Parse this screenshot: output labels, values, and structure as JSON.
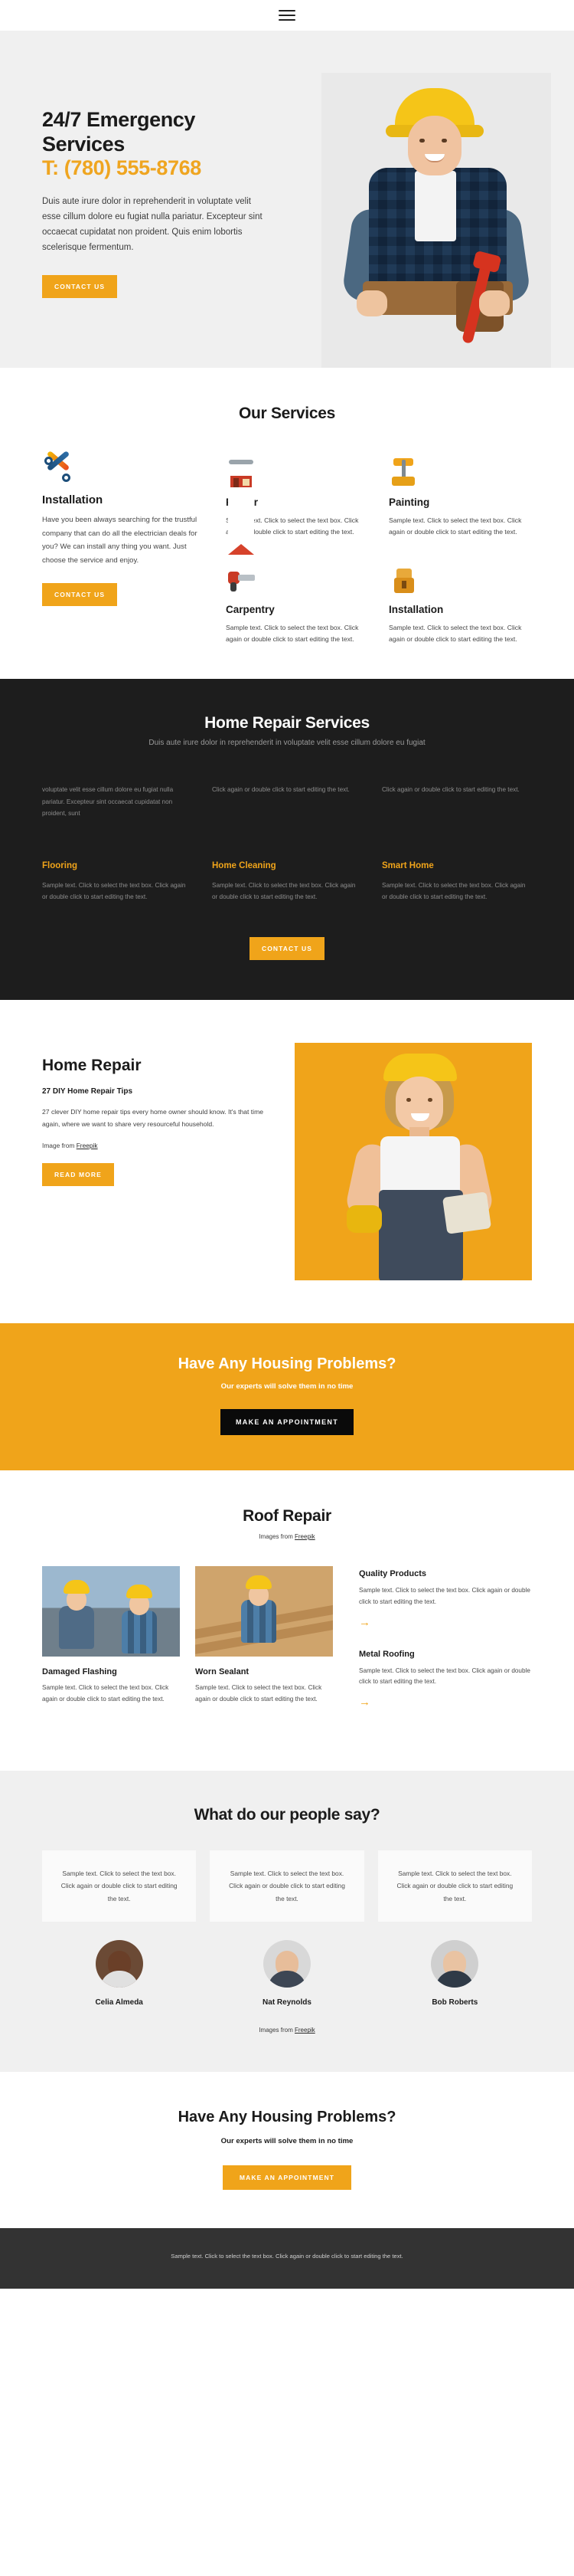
{
  "topbar": {
    "menu_icon": "hamburger-menu-icon"
  },
  "hero": {
    "title": "24/7 Emergency Services",
    "phone": "T: (780) 555-8768",
    "paragraph": "Duis aute irure dolor in reprehenderit in voluptate velit esse cillum dolore eu fugiat nulla pariatur. Excepteur sint occaecat cupidatat non proident. Quis enim lobortis scelerisque fermentum.",
    "cta": "CONTACT US",
    "image_alt": "worker-in-yellow-helmet-photo"
  },
  "services": {
    "title": "Our Services",
    "feature": {
      "icon": "crossed-tools-icon",
      "title": "Installation",
      "paragraph": "Have you been always searching for the trustful company that can do all the electrician deals for you? We can install any thing you want. Just choose the service and enjoy.",
      "cta": "CONTACT US"
    },
    "cards": [
      {
        "icon": "house-wrench-icon",
        "title": "Repair",
        "paragraph": "Sample text. Click to select the text box. Click again or double click to start editing the text."
      },
      {
        "icon": "paint-roller-icon",
        "title": "Painting",
        "paragraph": "Sample text. Click to select the text box. Click again or double click to start editing the text."
      },
      {
        "icon": "hand-saw-icon",
        "title": "Carpentry",
        "paragraph": "Sample text. Click to select the text box. Click again or double click to start editing the text."
      },
      {
        "icon": "toolbox-icon",
        "title": "Installation",
        "paragraph": "Sample text. Click to select the text box. Click again or double click to start editing the text."
      }
    ]
  },
  "dark_section": {
    "title": "Home Repair Services",
    "subtitle": "Duis aute irure dolor in reprehenderit in voluptate velit esse cillum dolore eu fugiat",
    "top_columns": [
      "voluptate velit esse cillum dolore eu fugiat nulla pariatur. Excepteur sint occaecat cupidatat non proident, sunt",
      "Click again or double click to start editing the text.",
      "Click again or double click to start editing the text."
    ],
    "columns": [
      {
        "title": "Flooring",
        "paragraph": "Sample text. Click to select the text box. Click again or double click to start editing the text."
      },
      {
        "title": "Home Cleaning",
        "paragraph": "Sample text. Click to select the text box. Click again or double click to start editing the text."
      },
      {
        "title": "Smart Home",
        "paragraph": "Sample text. Click to select the text box. Click again or double click to start editing the text."
      }
    ],
    "cta": "CONTACT US"
  },
  "home_repair": {
    "title": "Home Repair",
    "subtitle": "27 DIY Home Repair Tips",
    "paragraph": "27 clever DIY home repair tips every home owner should know. It's that time again, where we want to share very resourceful household.",
    "credit_prefix": "Image from ",
    "credit_link": "Freepik",
    "cta": "READ MORE",
    "image_alt": "smiling-woman-worker-photo"
  },
  "amber_cta": {
    "title": "Have Any Housing Problems?",
    "subtitle": "Our experts will solve them in no time",
    "button": "MAKE AN APPOINTMENT"
  },
  "roof": {
    "title": "Roof Repair",
    "credit_prefix": "Images from ",
    "credit_link": "Freepik",
    "cards": [
      {
        "image_alt": "roofer-on-roof-photo",
        "title": "Damaged Flashing",
        "paragraph": "Sample text. Click to select the text box. Click again or double click to start editing the text."
      },
      {
        "image_alt": "carpenter-with-planks-photo",
        "title": "Worn Sealant",
        "paragraph": "Sample text. Click to select the text box. Click again or double click to start editing the text."
      }
    ],
    "side_items": [
      {
        "title": "Quality Products",
        "paragraph": "Sample text. Click to select the text box. Click again or double click to start editing the text.",
        "arrow": "→"
      },
      {
        "title": "Metal Roofing",
        "paragraph": "Sample text. Click to select the text box. Click again or double click to start editing the text.",
        "arrow": "→"
      }
    ]
  },
  "testimonials": {
    "title": "What do our people say?",
    "quotes": [
      "Sample text. Click to select the text box. Click again or double click to start editing the text.",
      "Sample text. Click to select the text box. Click again or double click to start editing the text.",
      "Sample text. Click to select the text box. Click again or double click to start editing the text."
    ],
    "people": [
      {
        "name": "Celia Almeda",
        "avatar_alt": "avatar-celia-almeda"
      },
      {
        "name": "Nat Reynolds",
        "avatar_alt": "avatar-nat-reynolds"
      },
      {
        "name": "Bob Roberts",
        "avatar_alt": "avatar-bob-roberts"
      }
    ],
    "credit_prefix": "Images from ",
    "credit_link": "Freepik"
  },
  "bottom_cta": {
    "title": "Have Any Housing Problems?",
    "subtitle": "Our experts will solve them in no time",
    "button": "MAKE AN APPOINTMENT"
  },
  "footer": {
    "text": "Sample text. Click to select the text box. Click again or double click to start editing the text."
  },
  "colors": {
    "accent": "#f0a41a",
    "dark": "#1d1d1d",
    "footer": "#333333",
    "hero_bg": "#f0f0f0"
  }
}
